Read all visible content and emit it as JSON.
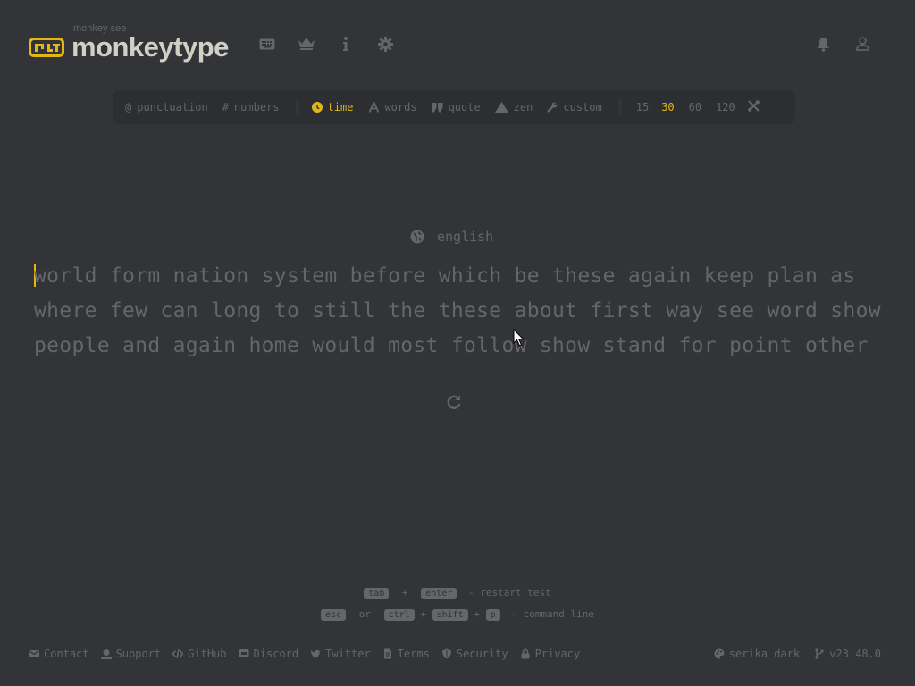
{
  "header": {
    "logo_top": "monkey see",
    "logo_text": "monkeytype",
    "nav_icons": [
      "keyboard-icon",
      "crown-icon",
      "info-icon",
      "gear-icon"
    ],
    "right_icons": [
      "bell-icon",
      "user-icon"
    ]
  },
  "config": {
    "punctuation": "punctuation",
    "numbers": "numbers",
    "modes": [
      {
        "label": "time",
        "icon": "clock-icon",
        "active": true
      },
      {
        "label": "words",
        "icon": "font-icon",
        "active": false
      },
      {
        "label": "quote",
        "icon": "quote-icon",
        "active": false
      },
      {
        "label": "zen",
        "icon": "mountain-icon",
        "active": false
      },
      {
        "label": "custom",
        "icon": "wrench-icon",
        "active": false
      }
    ],
    "times": [
      "15",
      "30",
      "60",
      "120"
    ],
    "active_time": "30"
  },
  "language": "english",
  "words": {
    "line1": "world form nation system before which be these again keep plan as",
    "line2": "where few can long to still the these about first way see word show",
    "line3": "people and again home would most follow show stand for point other"
  },
  "keytips": {
    "tab": "tab",
    "plus": "+",
    "enter": "enter",
    "restart_text": "- restart test",
    "esc": "esc",
    "or": "or",
    "ctrl": "ctrl",
    "shift": "shift",
    "p": "p",
    "command_text": "- command line"
  },
  "footer": {
    "links": [
      {
        "label": "Contact",
        "icon": "envelope-icon"
      },
      {
        "label": "Support",
        "icon": "donate-icon"
      },
      {
        "label": "GitHub",
        "icon": "code-icon"
      },
      {
        "label": "Discord",
        "icon": "discord-icon"
      },
      {
        "label": "Twitter",
        "icon": "twitter-icon"
      },
      {
        "label": "Terms",
        "icon": "file-icon"
      },
      {
        "label": "Security",
        "icon": "shield-icon"
      },
      {
        "label": "Privacy",
        "icon": "lock-icon"
      }
    ],
    "theme": "serika dark",
    "version": "v23.48.0"
  },
  "colors": {
    "accent": "#e2b714",
    "background": "#323437",
    "sub": "#646669",
    "text": "#d1d0c5"
  }
}
